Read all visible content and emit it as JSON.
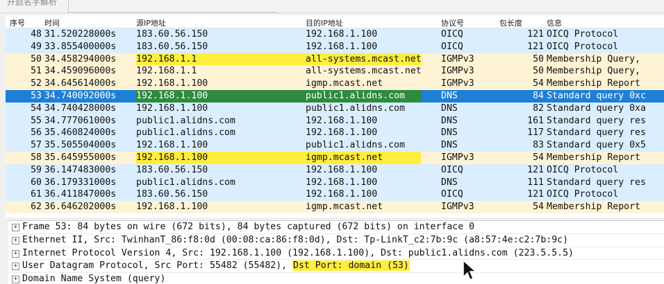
{
  "top_title": "开启名字解析",
  "columns": {
    "no": "序号",
    "time": "时间",
    "src": "源IP地址",
    "dst": "目的IP地址",
    "protocol": "协议号",
    "length": "包长度",
    "info": "信息"
  },
  "packets": [
    {
      "no": "48",
      "time": "31.520228000s",
      "src": "183.60.56.150",
      "dst": "192.168.1.100",
      "protocol": "OICQ",
      "length": "121",
      "info": "OICQ Protocol",
      "row_style": "udp",
      "highlight": ""
    },
    {
      "no": "49",
      "time": "33.855400000s",
      "src": "183.60.56.150",
      "dst": "192.168.1.100",
      "protocol": "OICQ",
      "length": "121",
      "info": "OICQ Protocol",
      "row_style": "udp",
      "highlight": ""
    },
    {
      "no": "50",
      "time": "34.458294000s",
      "src": "192.168.1.1",
      "dst": "all-systems.mcast.net",
      "protocol": "IGMPv3",
      "length": "50",
      "info": "Membership Query,",
      "row_style": "igmp",
      "highlight": "src_dst"
    },
    {
      "no": "51",
      "time": "34.459096000s",
      "src": "192.168.1.1",
      "dst": "all-systems.mcast.net",
      "protocol": "IGMPv3",
      "length": "50",
      "info": "Membership Query,",
      "row_style": "igmp",
      "highlight": ""
    },
    {
      "no": "52",
      "time": "34.645614000s",
      "src": "192.168.1.100",
      "dst": "igmp.mcast.net",
      "protocol": "IGMPv3",
      "length": "54",
      "info": "Membership Report",
      "row_style": "igmp",
      "highlight": ""
    },
    {
      "no": "53",
      "time": "34.740092000s",
      "src": "192.168.1.100",
      "dst": "public1.alidns.com",
      "protocol": "DNS",
      "length": "84",
      "info": "Standard query 0xc",
      "row_style": "selected",
      "highlight": "src_dst"
    },
    {
      "no": "54",
      "time": "34.740428000s",
      "src": "192.168.1.100",
      "dst": "public1.alidns.com",
      "protocol": "DNS",
      "length": "82",
      "info": "Standard query 0xa",
      "row_style": "udp",
      "highlight": ""
    },
    {
      "no": "55",
      "time": "34.777061000s",
      "src": "public1.alidns.com",
      "dst": "192.168.1.100",
      "protocol": "DNS",
      "length": "161",
      "info": "Standard query res",
      "row_style": "udp",
      "highlight": ""
    },
    {
      "no": "56",
      "time": "35.460824000s",
      "src": "public1.alidns.com",
      "dst": "192.168.1.100",
      "protocol": "DNS",
      "length": "117",
      "info": "Standard query res",
      "row_style": "udp",
      "highlight": ""
    },
    {
      "no": "57",
      "time": "35.505504000s",
      "src": "192.168.1.100",
      "dst": "public1.alidns.com",
      "protocol": "DNS",
      "length": "83",
      "info": "Standard query 0x5",
      "row_style": "udp",
      "highlight": ""
    },
    {
      "no": "58",
      "time": "35.645955000s",
      "src": "192.168.1.100",
      "dst": "igmp.mcast.net",
      "protocol": "IGMPv3",
      "length": "54",
      "info": "Membership Report",
      "row_style": "igmp",
      "highlight": "src_dst"
    },
    {
      "no": "59",
      "time": "36.147483000s",
      "src": "183.60.56.150",
      "dst": "192.168.1.100",
      "protocol": "OICQ",
      "length": "121",
      "info": "OICQ Protocol",
      "row_style": "udp",
      "highlight": ""
    },
    {
      "no": "60",
      "time": "36.179331000s",
      "src": "public1.alidns.com",
      "dst": "192.168.1.100",
      "protocol": "DNS",
      "length": "111",
      "info": "Standard query res",
      "row_style": "udp",
      "highlight": ""
    },
    {
      "no": "61",
      "time": "36.411847000s",
      "src": "183.60.56.150",
      "dst": "192.168.1.100",
      "protocol": "OICQ",
      "length": "121",
      "info": "OICQ Protocol",
      "row_style": "udp",
      "highlight": ""
    },
    {
      "no": "62",
      "time": "36.646202000s",
      "src": "192.168.1.100",
      "dst": "igmp.mcast.net",
      "protocol": "IGMPv3",
      "length": "54",
      "info": "Membership Report",
      "row_style": "igmp",
      "highlight": ""
    }
  ],
  "details": [
    {
      "text": "Frame 53: 84 bytes on wire (672 bits), 84 bytes captured (672 bits) on interface 0",
      "highlight": ""
    },
    {
      "text": "Ethernet II, Src: TwinhanT_86:f8:0d (00:08:ca:86:f8:0d), Dst: Tp-LinkT_c2:7b:9c (a8:57:4e:c2:7b:9c)",
      "highlight": ""
    },
    {
      "text": "Internet Protocol Version 4, Src: 192.168.1.100 (192.168.1.100), Dst: public1.alidns.com (223.5.5.5)",
      "highlight": ""
    },
    {
      "text": "User Datagram Protocol, Src Port: 55482 (55482), ",
      "highlight": "Dst Port: domain (53)"
    },
    {
      "text": "Domain Name System (query)",
      "highlight": ""
    }
  ],
  "expand_symbol": "+",
  "colors": {
    "udp_row": "#daeeff",
    "igmp_row": "#fff3d6",
    "selected_row": "#1e7fd6",
    "highlight": "#ffee3d",
    "highlight_on_selected": "#2d8a3e"
  },
  "icons": {
    "cursor": "mouse-pointer-icon"
  }
}
